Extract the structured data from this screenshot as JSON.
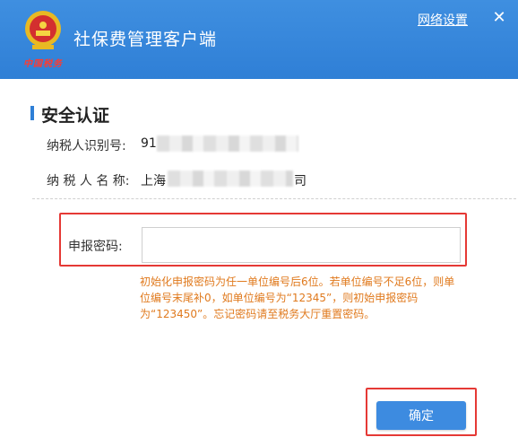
{
  "header": {
    "app_title": "社保费管理客户端",
    "logo_caption": "中国税务",
    "network_settings": "网络设置",
    "close_glyph": "✕"
  },
  "section": {
    "title": "安全认证"
  },
  "info": {
    "taxpayer_id_label": "纳税人识别号:",
    "taxpayer_id_value": "91",
    "taxpayer_name_label": "纳 税 人 名 称:",
    "taxpayer_name_value_start": "上海",
    "taxpayer_name_value_end": "司"
  },
  "password": {
    "label": "申报密码:",
    "value": "",
    "placeholder": ""
  },
  "hint": "初始化申报密码为任一单位编号后6位。若单位编号不足6位，则单位编号末尾补0，如单位编号为“12345”，则初始申报密码为“123450”。忘记密码请至税务大厅重置密码。",
  "confirm_button": "确定",
  "colors": {
    "header_bg": "#2f7fd6",
    "accent": "#3d8be0",
    "hint": "#e07a1e",
    "highlight_border": "#e53935"
  }
}
